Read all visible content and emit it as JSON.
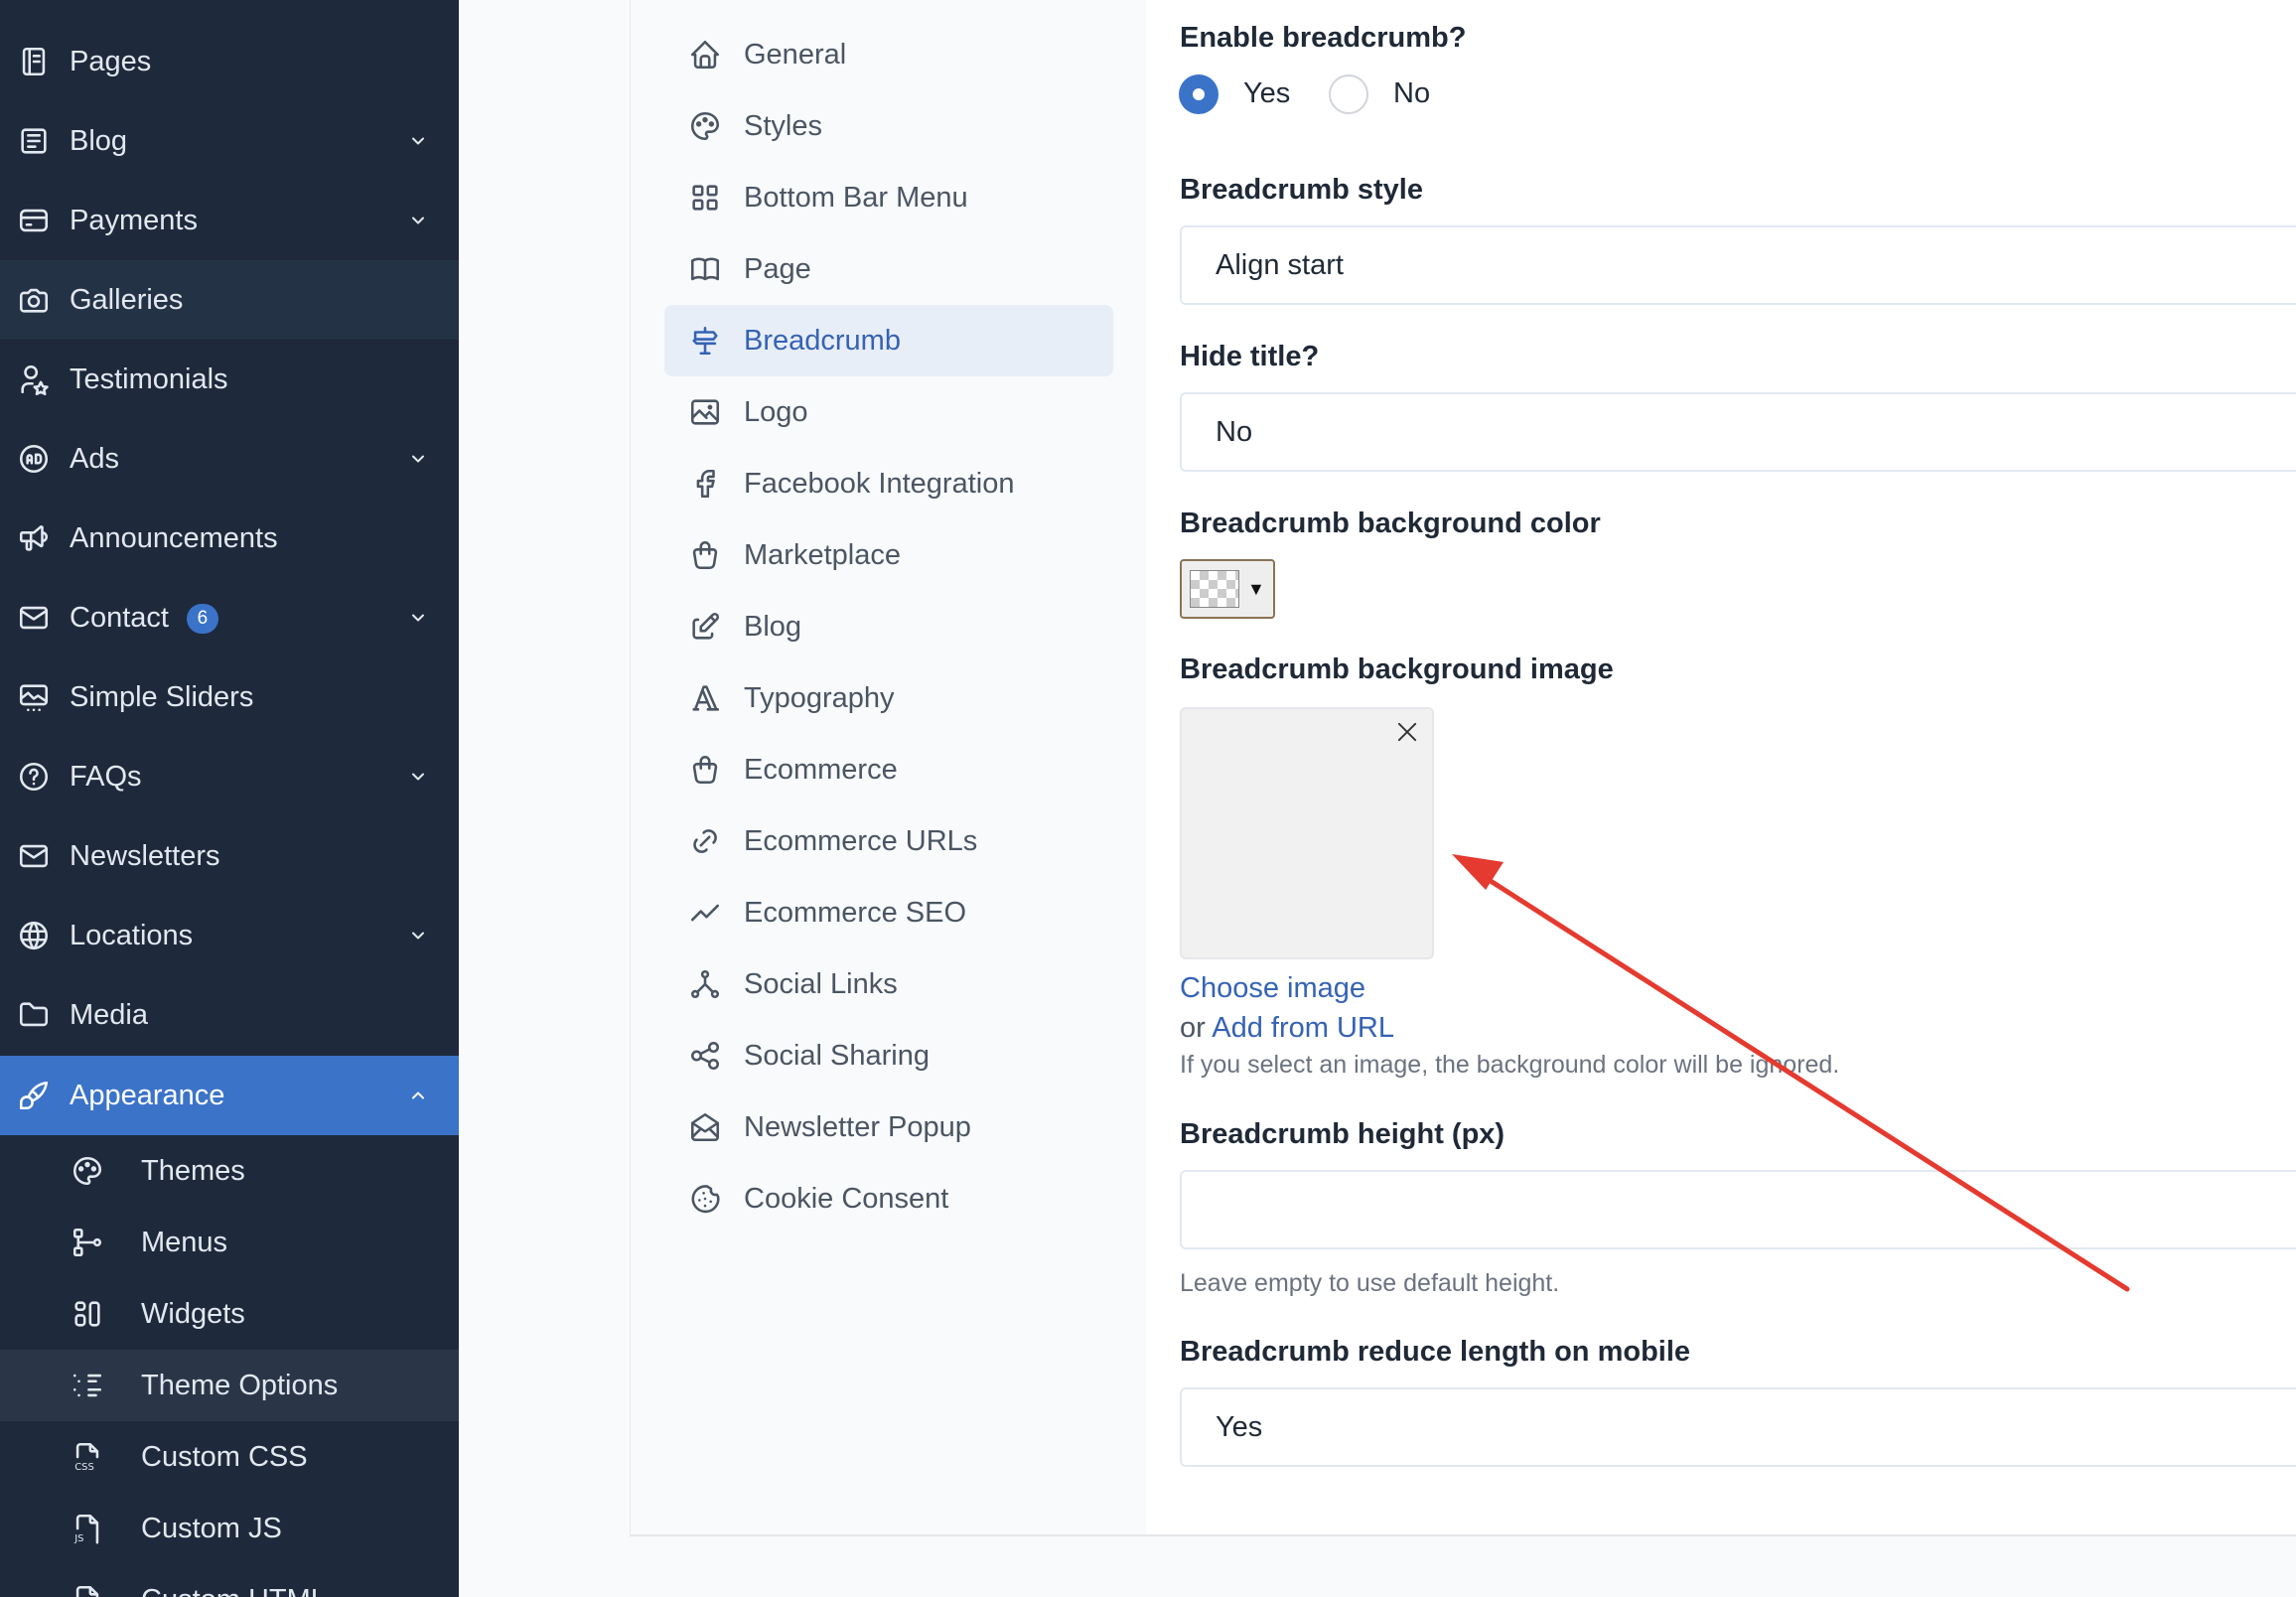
{
  "sidebar": {
    "items": [
      {
        "label": "Pages",
        "icon": "pages-icon",
        "chevron": false
      },
      {
        "label": "Blog",
        "icon": "blog-icon",
        "chevron": true
      },
      {
        "label": "Payments",
        "icon": "credit-card-icon",
        "chevron": true
      },
      {
        "label": "Galleries",
        "icon": "camera-icon",
        "chevron": false
      },
      {
        "label": "Testimonials",
        "icon": "user-star-icon",
        "chevron": false
      },
      {
        "label": "Ads",
        "icon": "ad-icon",
        "chevron": true
      },
      {
        "label": "Announcements",
        "icon": "speakerphone-icon",
        "chevron": false
      },
      {
        "label": "Contact",
        "icon": "mail-icon",
        "chevron": true,
        "badge": "6"
      },
      {
        "label": "Simple Sliders",
        "icon": "slideshow-icon",
        "chevron": false
      },
      {
        "label": "FAQs",
        "icon": "help-circle-icon",
        "chevron": true
      },
      {
        "label": "Newsletters",
        "icon": "mail-icon",
        "chevron": false
      },
      {
        "label": "Locations",
        "icon": "world-icon",
        "chevron": true
      },
      {
        "label": "Media",
        "icon": "folder-icon",
        "chevron": false
      },
      {
        "label": "Appearance",
        "icon": "brush-icon",
        "chevron": true
      }
    ],
    "sub_items": [
      {
        "label": "Themes",
        "icon": "palette-icon"
      },
      {
        "label": "Menus",
        "icon": "sitemap-icon"
      },
      {
        "label": "Widgets",
        "icon": "layout-icon"
      },
      {
        "label": "Theme Options",
        "icon": "list-details-icon"
      },
      {
        "label": "Custom CSS",
        "icon": "file-css-icon"
      },
      {
        "label": "Custom JS",
        "icon": "file-js-icon"
      },
      {
        "label": "Custom HTML",
        "icon": "file-html-icon"
      }
    ]
  },
  "settings_nav": {
    "items": [
      {
        "label": "General",
        "icon": "home-icon"
      },
      {
        "label": "Styles",
        "icon": "palette-icon"
      },
      {
        "label": "Bottom Bar Menu",
        "icon": "grid-icon"
      },
      {
        "label": "Page",
        "icon": "book-icon"
      },
      {
        "label": "Breadcrumb",
        "icon": "signpost-icon"
      },
      {
        "label": "Logo",
        "icon": "photo-icon"
      },
      {
        "label": "Facebook Integration",
        "icon": "facebook-icon"
      },
      {
        "label": "Marketplace",
        "icon": "shopping-bag-icon"
      },
      {
        "label": "Blog",
        "icon": "edit-icon"
      },
      {
        "label": "Typography",
        "icon": "typography-icon"
      },
      {
        "label": "Ecommerce",
        "icon": "shopping-bag-icon"
      },
      {
        "label": "Ecommerce URLs",
        "icon": "link-icon"
      },
      {
        "label": "Ecommerce SEO",
        "icon": "trend-icon"
      },
      {
        "label": "Social Links",
        "icon": "share-nodes-icon"
      },
      {
        "label": "Social Sharing",
        "icon": "share-icon"
      },
      {
        "label": "Newsletter Popup",
        "icon": "mail-open-icon"
      },
      {
        "label": "Cookie Consent",
        "icon": "cookie-icon"
      }
    ]
  },
  "form": {
    "enable_breadcrumb": {
      "label": "Enable breadcrumb?",
      "yes": "Yes",
      "no": "No"
    },
    "breadcrumb_style": {
      "label": "Breadcrumb style",
      "value": "Align start"
    },
    "hide_title": {
      "label": "Hide title?",
      "value": "No"
    },
    "bg_color": {
      "label": "Breadcrumb background color",
      "arrow": "▼"
    },
    "bg_image": {
      "label": "Breadcrumb background image",
      "choose": "Choose image",
      "or": "or",
      "add_url": "Add from URL",
      "help": "If you select an image, the background color will be ignored."
    },
    "height": {
      "label": "Breadcrumb height (px)",
      "value": "",
      "help": "Leave empty to use default height."
    },
    "reduce_length": {
      "label": "Breadcrumb reduce length on mobile",
      "value": "Yes"
    }
  },
  "colors": {
    "accent": "#3b73c9",
    "sidebar_bg": "#1e293b",
    "annotation_arrow": "#e53a2f"
  }
}
